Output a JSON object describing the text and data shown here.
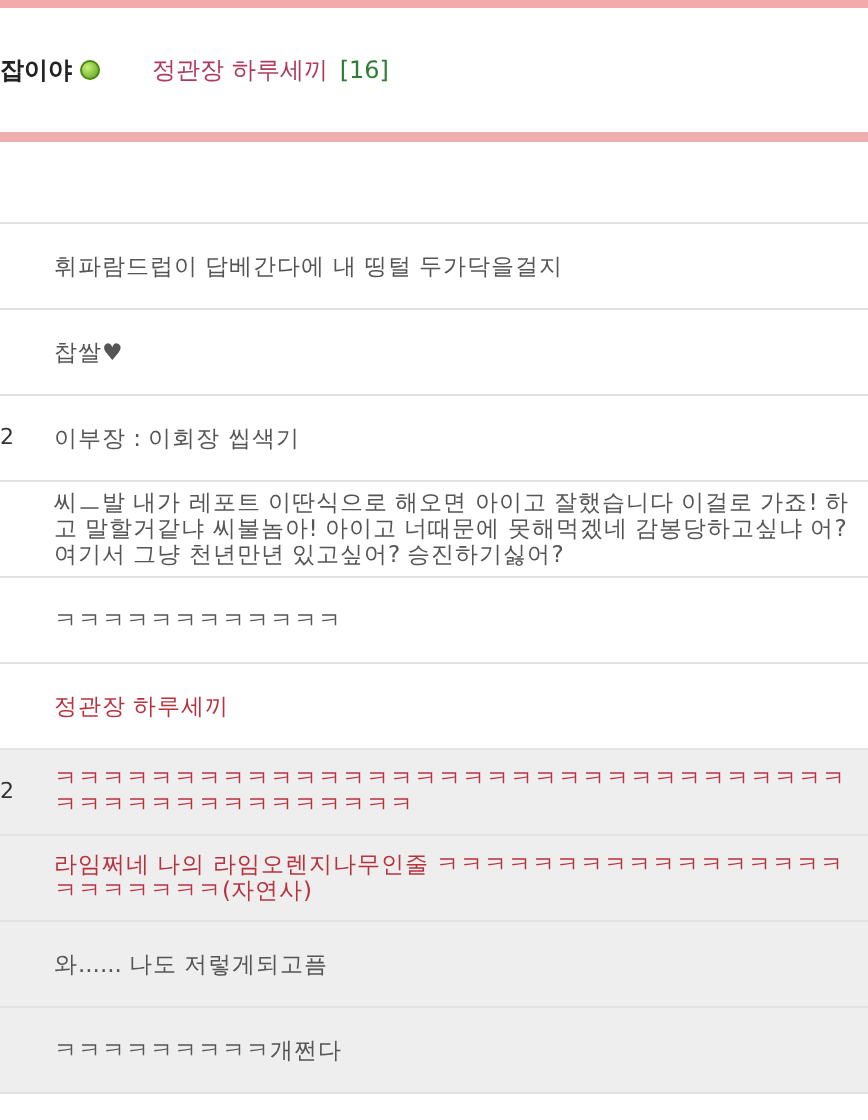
{
  "header": {
    "author": "잡이야",
    "online": true,
    "title": "정관장 하루세끼",
    "count": "[16]"
  },
  "comments": [
    {
      "text": "휘파람드럽이 답베간다에 내 띵털 두가닥을걸지",
      "kind": "plain",
      "highlighted": false
    },
    {
      "text": "찹쌀♥",
      "kind": "plain",
      "highlighted": false
    },
    {
      "side": "2",
      "text": "이부장 : 이회장 씹색기",
      "kind": "plain",
      "highlighted": false
    },
    {
      "text": "씨ㅡ발 내가 레포트 이딴식으로 해오면 아이고 잘했습니다 이걸로 가죠! 하고 말할거같냐 씨불놈아! 아이고 너때문에 못해먹겠네 감봉당하고싶냐 어? 여기서 그냥 천년만년 있고싶어? 승진하기싫어?",
      "kind": "plain",
      "highlighted": false
    },
    {
      "text": "ㅋㅋㅋㅋㅋㅋㅋㅋㅋㅋㅋㅋ",
      "kind": "plain",
      "highlighted": false
    },
    {
      "text": "정관장 하루세끼",
      "kind": "red",
      "highlighted": false
    },
    {
      "side": "2",
      "text": "ㅋㅋㅋㅋㅋㅋㅋㅋㅋㅋㅋㅋㅋㅋㅋㅋㅋㅋㅋㅋㅋㅋㅋㅋㅋㅋㅋㅋㅋㅋㅋㅋㅋㅋㅋㅋㅋㅋㅋㅋㅋㅋㅋㅋㅋㅋㅋㅋ",
      "kind": "red",
      "highlighted": true
    },
    {
      "text": "라임쩌네 나의 라임오렌지나무인줄 ㅋㅋㅋㅋㅋㅋㅋㅋㅋㅋㅋㅋㅋㅋㅋㅋㅋㅋㅋㅋㅋㅋㅋㅋ(자연사)",
      "kind": "red",
      "highlighted": true
    },
    {
      "text": "와...... 나도 저렇게되고픔",
      "kind": "plain",
      "highlighted": true
    },
    {
      "text": "ㅋㅋㅋㅋㅋㅋㅋㅋㅋ개쩐다",
      "kind": "plain",
      "highlighted": true
    }
  ]
}
